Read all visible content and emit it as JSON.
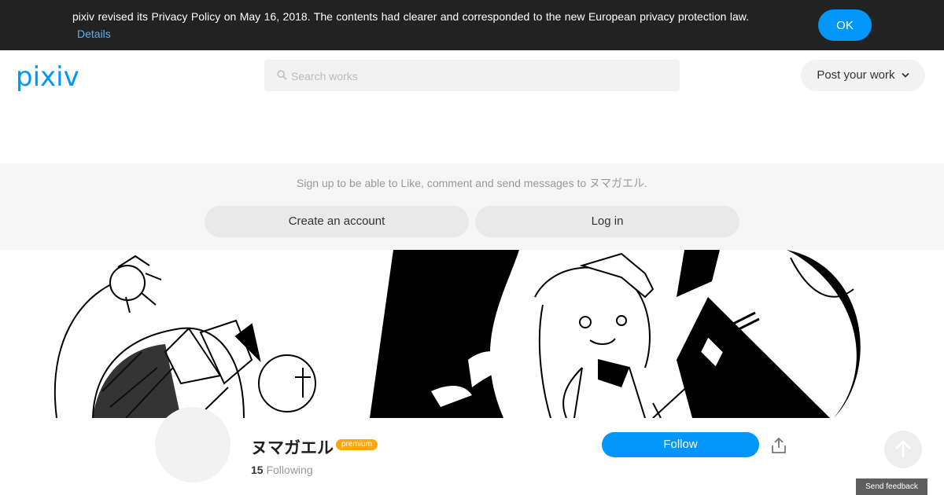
{
  "privacy": {
    "message": "pixiv revised its Privacy Policy on May 16, 2018. The contents had clearer and corresponded to the new European privacy protection law.",
    "details_label": "Details",
    "ok_label": "OK"
  },
  "header": {
    "logo": "pixiv",
    "search_placeholder": "Search works",
    "post_label": "Post your work"
  },
  "signup": {
    "message": "Sign up to be able to Like, comment and send messages to ヌマガエル.",
    "create_label": "Create an account",
    "login_label": "Log in"
  },
  "profile": {
    "name": "ヌマガエル",
    "badge": "premium",
    "following_count": "15",
    "following_label": "Following",
    "follow_label": "Follow"
  },
  "footer": {
    "feedback_label": "Send feedback"
  },
  "colors": {
    "accent": "#0096fa",
    "premium": "#ffa60a",
    "banner": "#222222"
  },
  "icons": [
    "search-icon",
    "chevron-down-icon",
    "share-icon",
    "arrow-up-icon"
  ]
}
